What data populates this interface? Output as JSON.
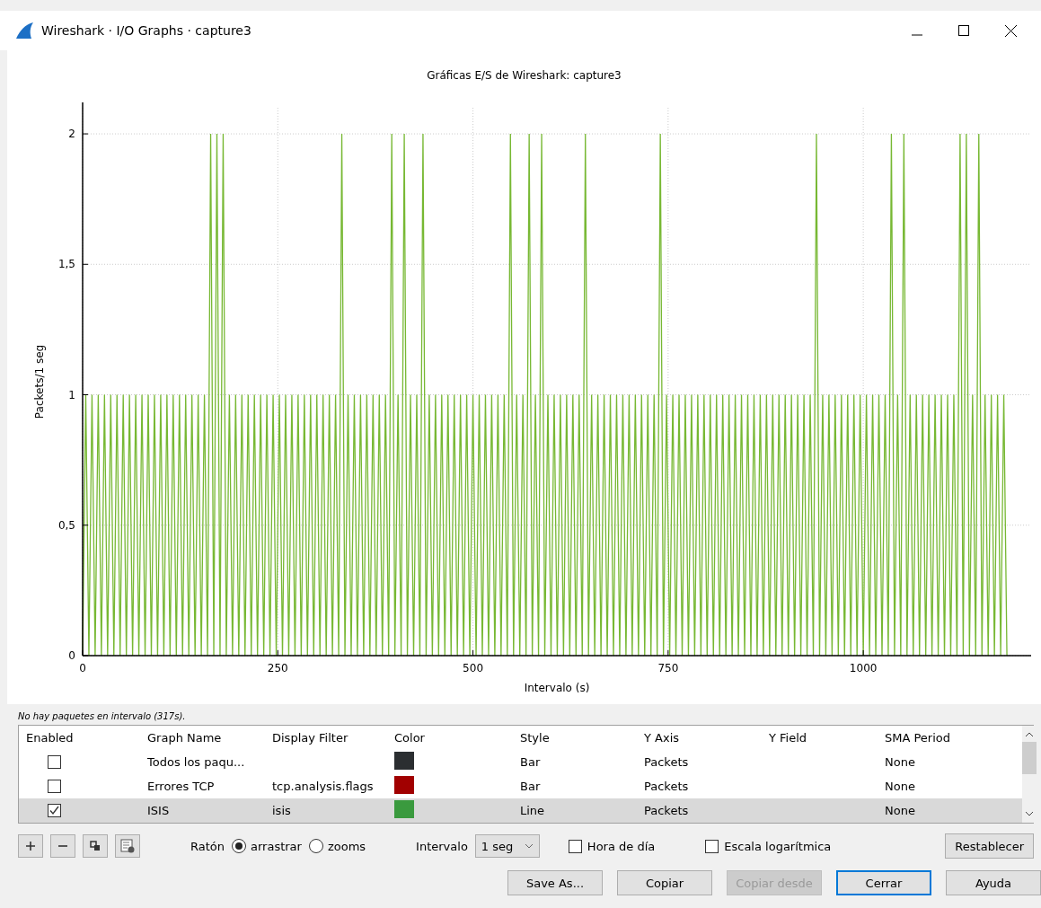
{
  "window": {
    "title": "Wireshark · I/O Graphs · capture3"
  },
  "graph": {
    "chart_data": {
      "type": "line",
      "title": "Gráficas E/S de Wireshark: capture3",
      "xlabel": "Intervalo (s)",
      "ylabel": "Packets/1 seg",
      "grid": true,
      "xlim": [
        0,
        1215
      ],
      "ylim": [
        0,
        2.1
      ],
      "xticks": [
        0,
        250,
        500,
        750,
        1000
      ],
      "yticks": [
        0,
        {
          "value": 0.5,
          "label": "0,5"
        },
        1,
        {
          "value": 1.5,
          "label": "1,5"
        },
        2
      ],
      "x": [
        0,
        4,
        8,
        12,
        16,
        20,
        24,
        28,
        32,
        36,
        40,
        44,
        48,
        52,
        56,
        60,
        64,
        68,
        72,
        76,
        80,
        84,
        88,
        92,
        96,
        100,
        104,
        108,
        112,
        116,
        120,
        124,
        128,
        132,
        136,
        140,
        144,
        148,
        152,
        156,
        160,
        164,
        168,
        172,
        176,
        180,
        184,
        188,
        192,
        196,
        200,
        204,
        208,
        212,
        216,
        220,
        224,
        228,
        232,
        236,
        240,
        244,
        248,
        252,
        256,
        260,
        264,
        268,
        272,
        276,
        280,
        284,
        288,
        292,
        296,
        300,
        304,
        308,
        312,
        316,
        320,
        324,
        328,
        332,
        336,
        340,
        344,
        348,
        352,
        356,
        360,
        364,
        368,
        372,
        376,
        380,
        384,
        388,
        392,
        396,
        400,
        404,
        408,
        412,
        416,
        420,
        424,
        428,
        432,
        436,
        440,
        444,
        448,
        452,
        456,
        460,
        464,
        468,
        472,
        476,
        480,
        484,
        488,
        492,
        496,
        500,
        504,
        508,
        512,
        516,
        520,
        524,
        528,
        532,
        536,
        540,
        544,
        548,
        552,
        556,
        560,
        564,
        568,
        572,
        576,
        580,
        584,
        588,
        592,
        596,
        600,
        604,
        608,
        612,
        616,
        620,
        624,
        628,
        632,
        636,
        640,
        644,
        648,
        652,
        656,
        660,
        664,
        668,
        672,
        676,
        680,
        684,
        688,
        692,
        696,
        700,
        704,
        708,
        712,
        716,
        720,
        724,
        728,
        732,
        736,
        740,
        744,
        748,
        752,
        756,
        760,
        764,
        768,
        772,
        776,
        780,
        784,
        788,
        792,
        796,
        800,
        804,
        808,
        812,
        816,
        820,
        824,
        828,
        832,
        836,
        840,
        844,
        848,
        852,
        856,
        860,
        864,
        868,
        872,
        876,
        880,
        884,
        888,
        892,
        896,
        900,
        904,
        908,
        912,
        916,
        920,
        924,
        928,
        932,
        936,
        940,
        944,
        948,
        952,
        956,
        960,
        964,
        968,
        972,
        976,
        980,
        984,
        988,
        992,
        996,
        1000,
        1004,
        1008,
        1012,
        1016,
        1020,
        1024,
        1028,
        1032,
        1036,
        1040,
        1044,
        1048,
        1052,
        1056,
        1060,
        1064,
        1068,
        1072,
        1076,
        1080,
        1084,
        1088,
        1092,
        1096,
        1100,
        1104,
        1108,
        1112,
        1116,
        1120,
        1124,
        1128,
        1132,
        1136,
        1140,
        1144,
        1148,
        1152,
        1156,
        1160,
        1164,
        1168,
        1172,
        1176,
        1180,
        1184
      ],
      "series": [
        {
          "color": "#77b833",
          "values": [
            0,
            1,
            0,
            1,
            0,
            1,
            0,
            1,
            0,
            1,
            0,
            1,
            0,
            1,
            0,
            1,
            0,
            1,
            0,
            1,
            0,
            1,
            0,
            1,
            0,
            1,
            0,
            1,
            0,
            1,
            0,
            1,
            0,
            1,
            0,
            1,
            0,
            1,
            0,
            1,
            0,
            2,
            0,
            2,
            0,
            2,
            0,
            1,
            0,
            1,
            0,
            1,
            0,
            1,
            0,
            1,
            0,
            1,
            0,
            1,
            0,
            1,
            0,
            1,
            0,
            1,
            0,
            1,
            0,
            1,
            0,
            1,
            0,
            1,
            0,
            1,
            0,
            1,
            0,
            1,
            0,
            1,
            0,
            2,
            0,
            1,
            0,
            1,
            0,
            1,
            0,
            1,
            0,
            1,
            0,
            1,
            0,
            1,
            0,
            2,
            0,
            1,
            0,
            2,
            0,
            1,
            0,
            1,
            0,
            2,
            0,
            1,
            0,
            1,
            0,
            1,
            0,
            1,
            0,
            1,
            0,
            1,
            0,
            1,
            0,
            1,
            0,
            1,
            0,
            1,
            0,
            1,
            0,
            1,
            0,
            1,
            0,
            2,
            0,
            1,
            0,
            1,
            0,
            2,
            0,
            1,
            0,
            2,
            0,
            1,
            0,
            1,
            0,
            1,
            0,
            1,
            0,
            1,
            0,
            1,
            0,
            2,
            0,
            1,
            0,
            1,
            0,
            1,
            0,
            1,
            0,
            1,
            0,
            1,
            0,
            1,
            0,
            1,
            0,
            1,
            0,
            1,
            0,
            1,
            0,
            2,
            0,
            1,
            0,
            1,
            0,
            1,
            0,
            1,
            0,
            1,
            0,
            1,
            0,
            1,
            0,
            1,
            0,
            1,
            0,
            1,
            0,
            1,
            0,
            1,
            0,
            1,
            0,
            1,
            0,
            1,
            0,
            1,
            0,
            1,
            0,
            1,
            0,
            1,
            0,
            1,
            0,
            1,
            0,
            1,
            0,
            1,
            0,
            1,
            0,
            2,
            0,
            1,
            0,
            1,
            0,
            1,
            0,
            1,
            0,
            1,
            0,
            1,
            0,
            1,
            0,
            1,
            0,
            1,
            0,
            1,
            0,
            1,
            0,
            2,
            0,
            1,
            0,
            2,
            0,
            1,
            0,
            1,
            0,
            1,
            0,
            1,
            0,
            1,
            0,
            1,
            0,
            1,
            0,
            1,
            0,
            2,
            0,
            2,
            0,
            1,
            0,
            2,
            0,
            1,
            0,
            1,
            0,
            1,
            0,
            1,
            0
          ]
        }
      ]
    }
  },
  "status": "No hay paquetes en intervalo (317s).",
  "table": {
    "columns": [
      "Enabled",
      "Graph Name",
      "Display Filter",
      "Color",
      "Style",
      "Y Axis",
      "Y Field",
      "SMA Period"
    ],
    "rows": [
      {
        "checked": false,
        "selected": false,
        "name": "Todos los paqu...",
        "filter": "",
        "color": "#2b2e31",
        "style": "Bar",
        "y_axis": "Packets",
        "sma": "None"
      },
      {
        "checked": false,
        "selected": false,
        "name": "Errores TCP",
        "filter": "tcp.analysis.flags",
        "color": "#a10000",
        "style": "Bar",
        "y_axis": "Packets",
        "sma": "None"
      },
      {
        "checked": true,
        "selected": true,
        "name": "ISIS",
        "filter": "isis",
        "color": "#3a9a3e",
        "style": "Line",
        "y_axis": "Packets",
        "sma": "None"
      }
    ]
  },
  "toolbar": {
    "mouse_label": "Ratón",
    "mouse_modes": [
      {
        "label": "arrastrar",
        "selected": true
      },
      {
        "label": "zooms",
        "selected": false
      }
    ],
    "interval_label": "Intervalo",
    "interval": "1 seg",
    "time_of_day": {
      "label": "Hora de día",
      "checked": false
    },
    "log_scale": {
      "label": "Escala logarítmica",
      "checked": false
    },
    "reset": "Restablecer"
  },
  "buttons": [
    {
      "label": "Save As...",
      "disabled": false,
      "default": false
    },
    {
      "label": "Copiar",
      "disabled": false,
      "default": false
    },
    {
      "label": "Copiar desde",
      "disabled": true,
      "default": false
    },
    {
      "label": "Cerrar",
      "disabled": false,
      "default": true
    },
    {
      "label": "Ayuda",
      "disabled": false,
      "default": false
    }
  ]
}
